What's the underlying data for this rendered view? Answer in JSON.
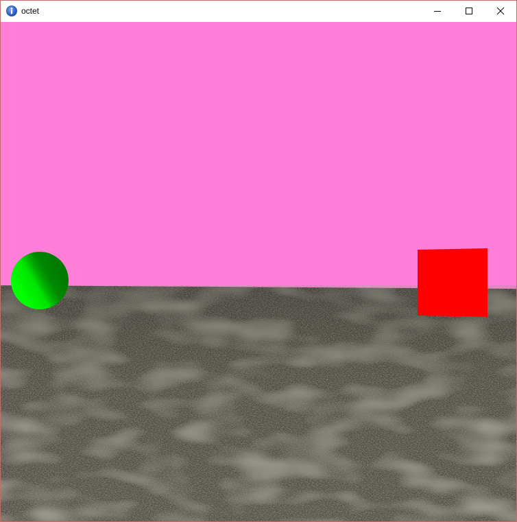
{
  "window": {
    "title": "octet",
    "app_icon": "info-icon",
    "controls": [
      "minimize-icon",
      "maximize-icon",
      "close-icon"
    ]
  },
  "scene": {
    "sky_color": "#ff7ed8",
    "ground_color": "#4f4b41",
    "sphere_color": "#00d800",
    "cube_color": "#ff0000"
  }
}
